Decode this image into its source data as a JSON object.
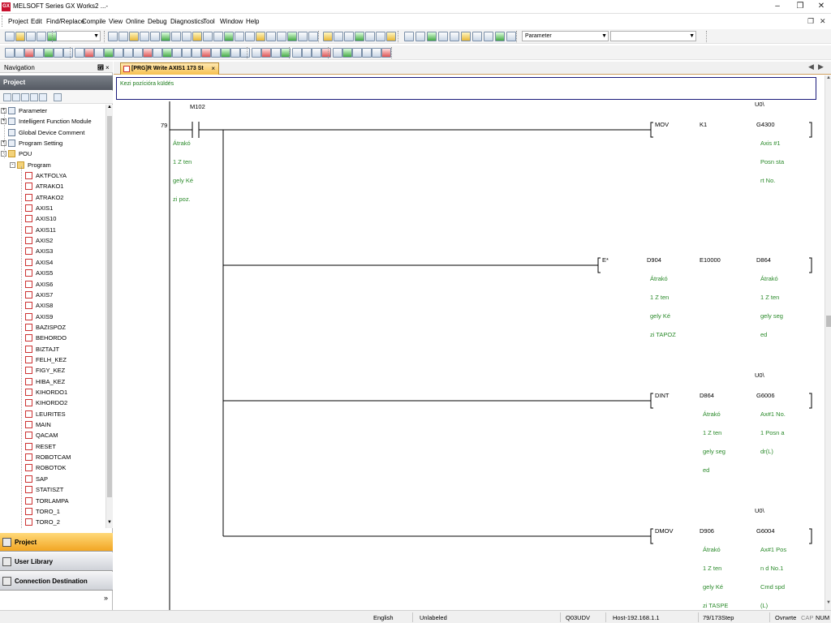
{
  "window": {
    "title": "MELSOFT Series GX Works2 ...-",
    "app_icon": "GX"
  },
  "menu": {
    "items": [
      "Project",
      "Edit",
      "Find/Replace",
      "Compile",
      "View",
      "Online",
      "Debug",
      "Diagnostics",
      "Tool",
      "Window",
      "Help"
    ]
  },
  "toolbar": {
    "combo_main": "",
    "combo_parameter": "Parameter",
    "combo_third": ""
  },
  "navigation": {
    "title": "Navigation",
    "pin_label": "⵮",
    "close_label": "×",
    "project_header": "Project",
    "tree_top": [
      {
        "label": "Parameter",
        "exp": "+"
      },
      {
        "label": "Intelligent Function Module",
        "exp": "+"
      },
      {
        "label": "Global Device Comment",
        "exp": ""
      },
      {
        "label": "Program Setting",
        "exp": "+"
      },
      {
        "label": "POU",
        "exp": "-"
      },
      {
        "label": "Program",
        "exp": "-"
      }
    ],
    "programs": [
      "AKTFOLYA",
      "ATRAKO1",
      "ATRAKO2",
      "AXIS1",
      "AXIS10",
      "AXIS11",
      "AXIS2",
      "AXIS3",
      "AXIS4",
      "AXIS5",
      "AXIS6",
      "AXIS7",
      "AXIS8",
      "AXIS9",
      "BAZISPOZ",
      "BEHORDO",
      "BIZTAJT",
      "FELH_KEZ",
      "FIGY_KEZ",
      "HIBA_KEZ",
      "KIHORDO1",
      "KIHORDO2",
      "LEURITES",
      "MAIN",
      "QACAM",
      "RESET",
      "ROBOTCAM",
      "ROBOTOK",
      "SAP",
      "STATISZT",
      "TORLAMPA",
      "TORO_1",
      "TORO_2"
    ],
    "bottom_buttons": [
      "Project",
      "User Library",
      "Connection Destination"
    ],
    "more_label": "»"
  },
  "tab": {
    "label": "[PRG]R Write AXIS1 173 St",
    "close": "×"
  },
  "ladder": {
    "statement": "Kezi pozícióra küldés",
    "step": "79",
    "contact_device": "M102",
    "contact_comment": [
      "Átrakó",
      "1 Z ten",
      "gely Ké",
      "zi poz."
    ],
    "rungs": [
      {
        "inst": "MOV",
        "op1": "K1",
        "op1_comment": [],
        "op2_label": "U0\\",
        "op2": "G4300",
        "op2_comment": [
          "Axis #1",
          "Posn sta",
          "rt No."
        ]
      },
      {
        "inst": "E*",
        "op1": "D904",
        "op1_comment": [
          "Átrakó",
          "1 Z ten",
          "gely Ké",
          "zi TAPOZ"
        ],
        "mid": "E10000",
        "op2_label": "",
        "op2": "D864",
        "op2_comment": [
          "Átrakó",
          "1 Z ten",
          "gely seg",
          "ed"
        ]
      },
      {
        "inst": "DINT",
        "op1": "D864",
        "op1_comment": [
          "Átrakó",
          "1 Z ten",
          "gely seg",
          "ed"
        ],
        "op2_label": "U0\\",
        "op2": "G6006",
        "op2_comment": [
          "Ax#1 No.",
          "1 Posn a",
          "dr(L)"
        ]
      },
      {
        "inst": "DMOV",
        "op1": "D906",
        "op1_comment": [
          "Átrakó",
          "1 Z ten",
          "gely Ké",
          "zi TASPE"
        ],
        "op2_label": "U0\\",
        "op2": "G6004",
        "op2_comment": [
          "Ax#1 Pos",
          "n d No.1",
          "Cmd spd",
          "(L)"
        ]
      }
    ]
  },
  "status": {
    "language": "English",
    "label": "Unlabeled",
    "cpu": "Q03UDV",
    "host": "Host-192.168.1.1",
    "step": "79/173Step",
    "mode": "Ovrwrte",
    "cap": "CAP",
    "num": "NUM"
  },
  "colors": {
    "comment_green": "#2a8a2a",
    "tab_orange": "#f6c050",
    "statement_border": "#1a1a7a"
  }
}
